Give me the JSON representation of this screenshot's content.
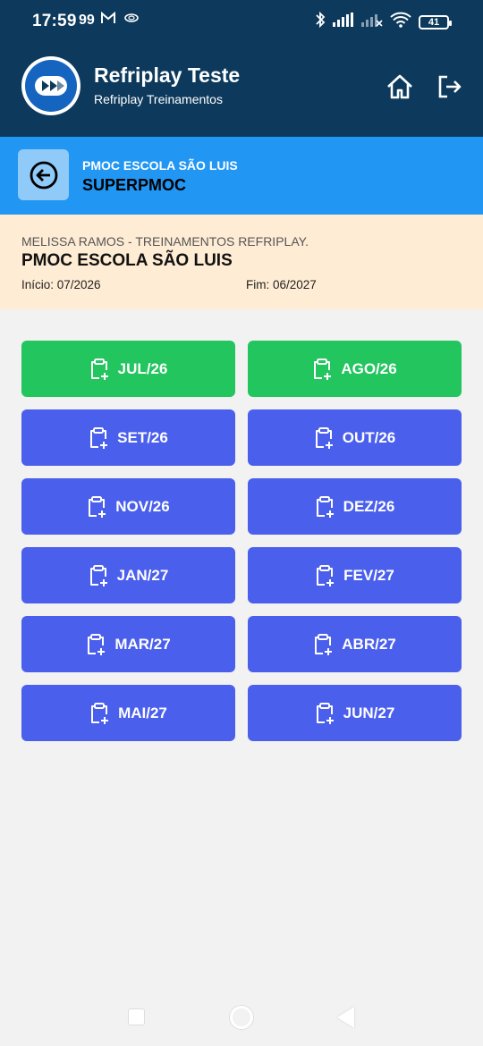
{
  "status_bar": {
    "time": "17:59",
    "extra": "99",
    "battery": "41"
  },
  "header": {
    "title": "Refriplay Teste",
    "subtitle": "Refriplay Treinamentos"
  },
  "context": {
    "subtitle": "PMOC ESCOLA SÃO LUIS",
    "title": "SUPERPMOC"
  },
  "info": {
    "client": "MELISSA RAMOS - TREINAMENTOS REFRIPLAY.",
    "title": "PMOC ESCOLA SÃO LUIS",
    "start": "Início: 07/2026",
    "end": "Fim: 06/2027"
  },
  "colors": {
    "header_bg": "#0d3a5c",
    "context_bg": "#2196f3",
    "info_bg": "#ffecd4",
    "month_done": "#22c55e",
    "month_pending": "#4a5fec"
  },
  "months": [
    {
      "label": "JUL/26",
      "status": "done"
    },
    {
      "label": "AGO/26",
      "status": "done"
    },
    {
      "label": "SET/26",
      "status": "pending"
    },
    {
      "label": "OUT/26",
      "status": "pending"
    },
    {
      "label": "NOV/26",
      "status": "pending"
    },
    {
      "label": "DEZ/26",
      "status": "pending"
    },
    {
      "label": "JAN/27",
      "status": "pending"
    },
    {
      "label": "FEV/27",
      "status": "pending"
    },
    {
      "label": "MAR/27",
      "status": "pending"
    },
    {
      "label": "ABR/27",
      "status": "pending"
    },
    {
      "label": "MAI/27",
      "status": "pending"
    },
    {
      "label": "JUN/27",
      "status": "pending"
    }
  ],
  "icons": {
    "month": "clipboard-plus-icon",
    "home": "home-icon",
    "logout": "logout-icon",
    "back": "arrow-left-circle-icon"
  }
}
